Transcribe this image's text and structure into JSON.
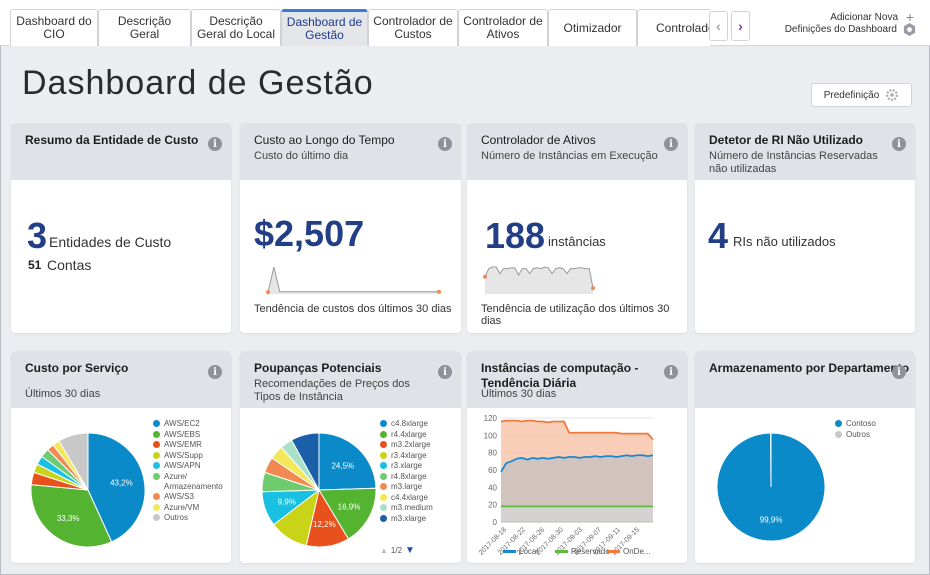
{
  "tabs": [
    {
      "label": "Dashboard do CIO"
    },
    {
      "label": "Descrição Geral"
    },
    {
      "label": "Descrição Geral do Local"
    },
    {
      "label": "Dashboard de Gestão"
    },
    {
      "label": "Controlador de Custos"
    },
    {
      "label": "Controlador de Ativos"
    },
    {
      "label": "Otimizador"
    },
    {
      "label": "Controlador"
    }
  ],
  "header": {
    "add_new": "Adicionar Nova",
    "dashboard_settings": "Definições do Dashboard",
    "title": "Dashboard de Gestão",
    "preset": "Predefinição"
  },
  "cards": {
    "cost_entity": {
      "title": "Resumo da Entidade de Custo",
      "big": "3",
      "big_label": "Entidades de Custo",
      "small": "51",
      "small_label": "Contas"
    },
    "cost_time": {
      "title": "Custo ao Longo do Tempo",
      "sub": "Custo do último dia",
      "big": "$2,507",
      "trend": "Tendência de custos dos últimos 30 dias"
    },
    "asset": {
      "title": "Controlador de Ativos",
      "sub": "Número de Instâncias em Execução",
      "big": "188",
      "big_label": "instâncias",
      "trend": "Tendência de utilização dos últimos 30 dias"
    },
    "ri": {
      "title": "Detetor de RI Não Utilizado",
      "sub": "Número de Instâncias Reservadas não utilizadas",
      "big": "4",
      "big_label": "RIs não utilizados"
    },
    "service": {
      "title": "Custo por Serviço",
      "sub": "Últimos 30 dias"
    },
    "savings": {
      "title": "Poupanças Potenciais",
      "sub": "Recomendações de Preços dos Tipos de Instância",
      "pager": "1/2"
    },
    "compute": {
      "title": "Instâncias de computação - Tendência Diária",
      "sub": "Últimos 30 dias"
    },
    "storage": {
      "title": "Armazenamento por Departamento"
    }
  },
  "chart_data": [
    {
      "type": "pie",
      "title": "Custo por Serviço",
      "categories": [
        "AWS/EC2",
        "AWS/EBS",
        "AWS/EMR",
        "AWS/Supp",
        "AWS/APN",
        "Azure/ Armazenamento",
        "AWS/S3",
        "Azure/VM",
        "Outros"
      ],
      "values": [
        43.2,
        33.3,
        3.5,
        2.5,
        2.5,
        2.5,
        2,
        2,
        8.5
      ],
      "colors": [
        "#0a8ac9",
        "#54b431",
        "#e8511c",
        "#c9d418",
        "#18c1e1",
        "#6ecb6e",
        "#f08a52",
        "#f3e85a",
        "#c8c8c8"
      ],
      "labels": {
        "0": "43,2%",
        "1": "33,3%"
      }
    },
    {
      "type": "pie",
      "title": "Poupanças Potenciais",
      "categories": [
        "c4.8xlarge",
        "r4.4xlarge",
        "m3.2xlarge",
        "r3.4xlarge",
        "r3.xlarge",
        "r4.8xlarge",
        "m3.large",
        "c4.4xlarge",
        "m3.medium",
        "m3.xlarge"
      ],
      "values": [
        24.5,
        16.9,
        12.2,
        11,
        9.9,
        5.5,
        4.5,
        4,
        3.5,
        8
      ],
      "colors": [
        "#0a8ac9",
        "#54b431",
        "#e8511c",
        "#c9d418",
        "#18c1e1",
        "#6ecb6e",
        "#f08a52",
        "#f3e85a",
        "#a8e0c8",
        "#1a5fa8"
      ],
      "labels": {
        "0": "24,5%",
        "1": "16,9%",
        "2": "12,2%",
        "4": "9,9%"
      }
    },
    {
      "type": "area",
      "title": "Instâncias de computação - Tendência Diária",
      "x": [
        "2017-08-18",
        "2017-08-22",
        "2017-08-26",
        "2017-08-30",
        "2017-09-03",
        "2017-09-07",
        "2017-09-11",
        "2017-09-15"
      ],
      "ylim": [
        0,
        120
      ],
      "yticks": [
        0,
        20,
        40,
        60,
        80,
        100,
        120
      ],
      "series": [
        {
          "name": "Local",
          "color": "#1a88d0",
          "values": [
            58,
            68,
            70,
            73,
            74,
            72,
            74,
            73,
            74,
            73,
            74,
            75,
            74,
            75,
            75,
            74,
            75,
            75,
            76,
            75,
            76,
            76,
            75,
            76,
            77,
            76,
            77,
            77,
            76,
            77
          ]
        },
        {
          "name": "Reservado",
          "color": "#5dbb3a",
          "values": [
            18,
            18,
            18,
            18,
            18,
            18,
            18,
            18,
            18,
            18,
            18,
            18,
            18,
            18,
            18,
            18,
            18,
            18,
            18,
            18,
            18,
            18,
            18,
            18,
            18,
            18,
            18,
            18,
            18,
            18
          ]
        },
        {
          "name": "OnDe...",
          "color": "#f07a3a",
          "values": [
            116,
            117,
            117,
            117,
            116,
            117,
            117,
            116,
            116,
            115,
            116,
            116,
            116,
            103,
            103,
            103,
            103,
            103,
            103,
            103,
            103,
            103,
            103,
            102,
            102,
            102,
            102,
            102,
            102,
            95
          ]
        }
      ]
    },
    {
      "type": "pie",
      "title": "Armazenamento por Departamento",
      "categories": [
        "Contoso",
        "Outros"
      ],
      "values": [
        99.9,
        0.1
      ],
      "colors": [
        "#0a8ac9",
        "#c8c8c8"
      ],
      "labels": {
        "0": "99,9%"
      }
    }
  ],
  "sparklines": {
    "cost": [
      2,
      60,
      3,
      3,
      3,
      3,
      3,
      3,
      3,
      3,
      3,
      3,
      3,
      3,
      3,
      3,
      3,
      3,
      3,
      3,
      3,
      3,
      3,
      3,
      3,
      3,
      3,
      3,
      3,
      3
    ],
    "usage": [
      20,
      30,
      32,
      32,
      24,
      30,
      30,
      31,
      31,
      22,
      30,
      30,
      24,
      30,
      31,
      30,
      32,
      31,
      24,
      30,
      31,
      30,
      24,
      30,
      30,
      31,
      31,
      30,
      30,
      6
    ]
  }
}
